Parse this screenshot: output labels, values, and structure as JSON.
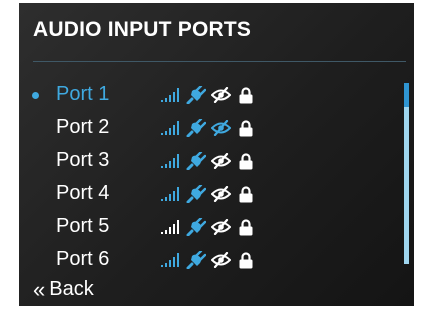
{
  "title": "AUDIO INPUT PORTS",
  "back_label": "Back",
  "colors": {
    "accent": "#3fa9e0",
    "text": "#ffffff",
    "panel": "#232323",
    "scroll_track": "#9fd6ef",
    "scroll_thumb": "#2f95d2"
  },
  "scroll_position": 0,
  "ports": [
    {
      "label": "Port 1",
      "selected": true,
      "signal_color": "#3fa9e0",
      "plug_color": "#3fa9e0",
      "visibility_color": "#ffffff",
      "icons": [
        "signal-icon",
        "plug-icon",
        "eye-off-icon",
        "lock-icon"
      ]
    },
    {
      "label": "Port 2",
      "selected": false,
      "signal_color": "#3fa9e0",
      "plug_color": "#3fa9e0",
      "visibility_color": "#3fa9e0",
      "icons": [
        "signal-icon",
        "plug-icon",
        "eye-off-icon",
        "lock-icon"
      ]
    },
    {
      "label": "Port 3",
      "selected": false,
      "signal_color": "#3fa9e0",
      "plug_color": "#3fa9e0",
      "visibility_color": "#ffffff",
      "icons": [
        "signal-icon",
        "plug-icon",
        "eye-off-icon",
        "lock-icon"
      ]
    },
    {
      "label": "Port 4",
      "selected": false,
      "signal_color": "#3fa9e0",
      "plug_color": "#3fa9e0",
      "visibility_color": "#ffffff",
      "icons": [
        "signal-icon",
        "plug-icon",
        "eye-off-icon",
        "lock-icon"
      ]
    },
    {
      "label": "Port 5",
      "selected": false,
      "signal_color": "#ffffff",
      "plug_color": "#3fa9e0",
      "visibility_color": "#ffffff",
      "icons": [
        "signal-icon",
        "plug-icon",
        "eye-off-icon",
        "lock-icon"
      ]
    },
    {
      "label": "Port 6",
      "selected": false,
      "signal_color": "#3fa9e0",
      "plug_color": "#3fa9e0",
      "visibility_color": "#ffffff",
      "icons": [
        "signal-icon",
        "plug-icon",
        "eye-off-icon",
        "lock-icon"
      ]
    }
  ]
}
